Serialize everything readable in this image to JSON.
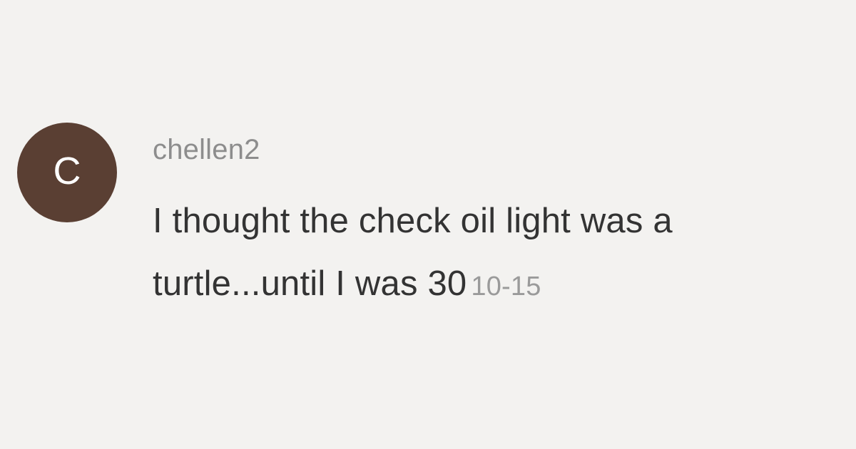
{
  "comment": {
    "avatar_initial": "C",
    "username": "chellen2",
    "text_line_1": "I thought the check oil light was a",
    "text_line_2": "turtle...until I was 30",
    "timestamp": "10-15"
  },
  "colors": {
    "background": "#f3f2f0",
    "avatar": "#5a3f33",
    "username": "#8d8d8d",
    "text": "#333333",
    "timestamp": "#9a9a9a"
  }
}
